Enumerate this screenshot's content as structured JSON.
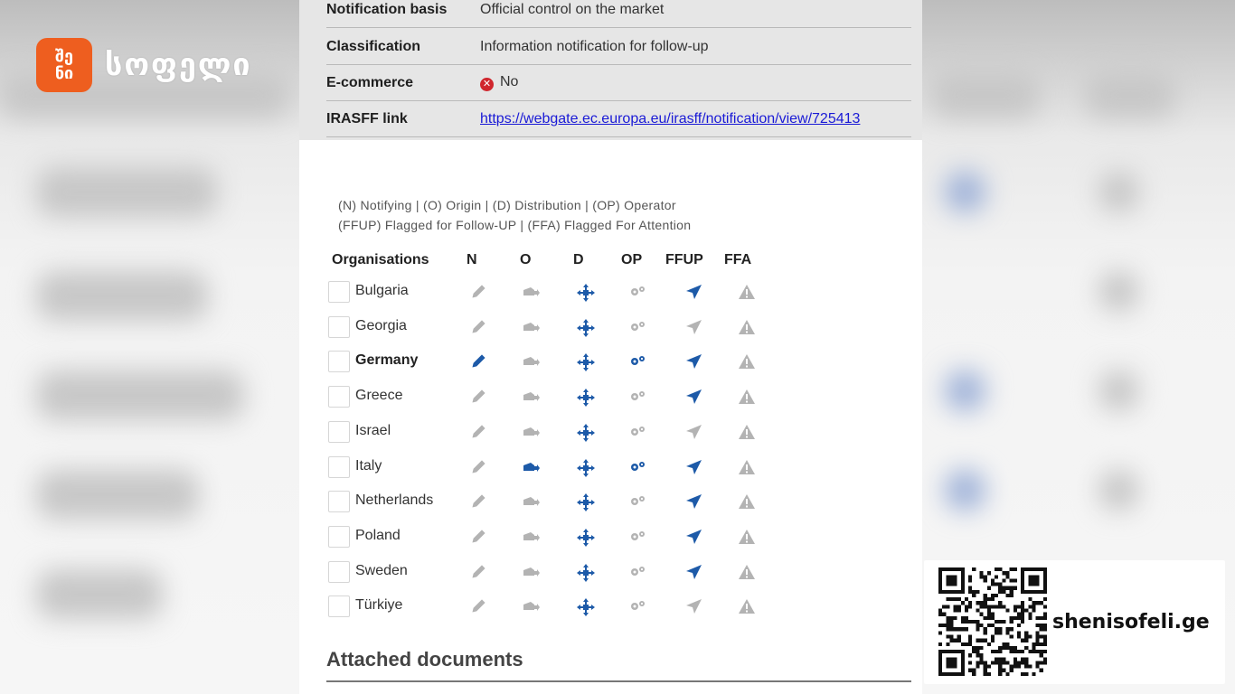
{
  "brand": {
    "logo_line1": "შე",
    "logo_line2": "ნი",
    "name": "სოფელი",
    "accent": "#ee5e1f"
  },
  "notification": {
    "basis_label": "Notification basis",
    "basis_value": "Official control on the market",
    "classification_label": "Classification",
    "classification_value": "Information notification for follow-up",
    "ecommerce_label": "E-commerce",
    "ecommerce_value": "No",
    "irasff_label": "IRASFF link",
    "irasff_value": "https://webgate.ec.europa.eu/irasff/notification/view/725413"
  },
  "legend": {
    "line1": "(N) Notifying | (O) Origin | (D) Distribution | (OP) Operator",
    "line2": "(FFUP) Flagged for Follow-UP | (FFA) Flagged For Attention"
  },
  "table": {
    "headers": [
      "Organisations",
      "N",
      "O",
      "D",
      "OP",
      "FFUP",
      "FFA"
    ],
    "rows": [
      {
        "name": "Bulgaria",
        "N": false,
        "O": false,
        "D": true,
        "OP": false,
        "FFUP": true,
        "FFA": false
      },
      {
        "name": "Georgia",
        "N": false,
        "O": false,
        "D": true,
        "OP": false,
        "FFUP": false,
        "FFA": false
      },
      {
        "name": "Germany",
        "N": true,
        "O": false,
        "D": true,
        "OP": true,
        "FFUP": true,
        "FFA": false
      },
      {
        "name": "Greece",
        "N": false,
        "O": false,
        "D": true,
        "OP": false,
        "FFUP": true,
        "FFA": false
      },
      {
        "name": "Israel",
        "N": false,
        "O": false,
        "D": true,
        "OP": false,
        "FFUP": false,
        "FFA": false
      },
      {
        "name": "Italy",
        "N": false,
        "O": true,
        "D": true,
        "OP": true,
        "FFUP": true,
        "FFA": false
      },
      {
        "name": "Netherlands",
        "N": false,
        "O": false,
        "D": true,
        "OP": false,
        "FFUP": true,
        "FFA": false
      },
      {
        "name": "Poland",
        "N": false,
        "O": false,
        "D": true,
        "OP": false,
        "FFUP": true,
        "FFA": false
      },
      {
        "name": "Sweden",
        "N": false,
        "O": false,
        "D": true,
        "OP": false,
        "FFUP": true,
        "FFA": false
      },
      {
        "name": "Türkiye",
        "N": false,
        "O": false,
        "D": true,
        "OP": false,
        "FFUP": false,
        "FFA": false
      }
    ]
  },
  "icons": {
    "N": "pencil-icon",
    "O": "truck-icon",
    "D": "distribution-arrows-icon",
    "OP": "gears-icon",
    "FFUP": "paper-plane-icon",
    "FFA": "warning-triangle-icon"
  },
  "colors": {
    "active": "#1d5aa8",
    "inactive": "#b3b3b3",
    "link": "#1a1ad6",
    "no_badge": "#d0262d"
  },
  "attached": {
    "title": "Attached documents"
  },
  "promo": {
    "site": "shenisofeli.ge"
  }
}
